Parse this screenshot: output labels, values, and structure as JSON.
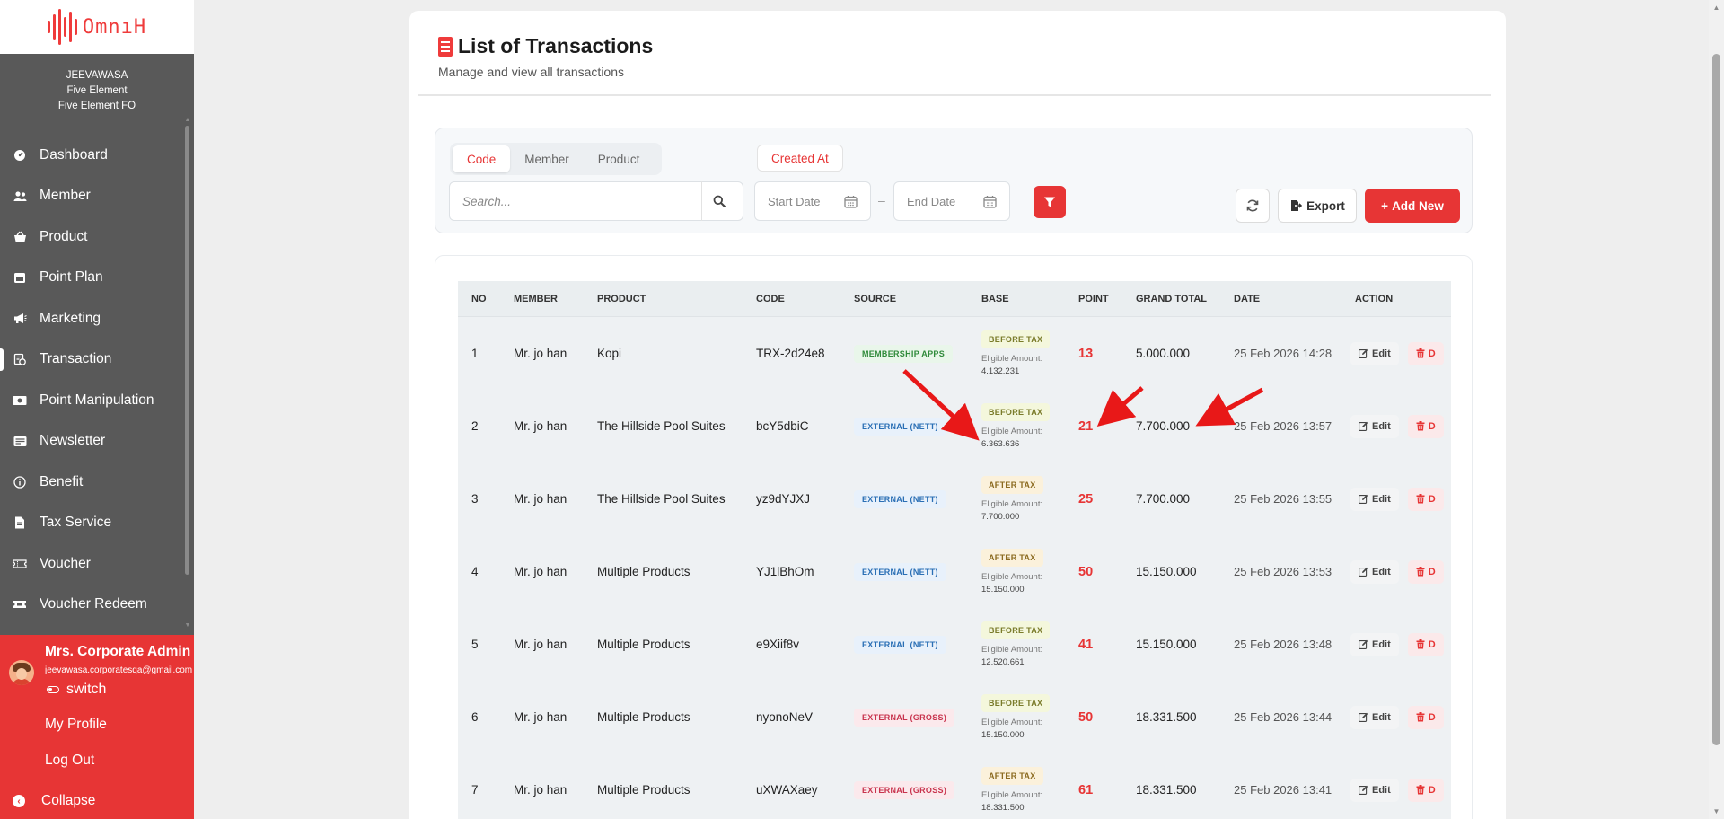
{
  "brand": {
    "logo_text": "OmnıH",
    "accent": "#e73535"
  },
  "org": {
    "line1": "JEEVAWASA",
    "line2": "Five Element",
    "line3": "Five Element FO"
  },
  "nav": [
    {
      "label": "Dashboard",
      "icon": "dashboard-icon"
    },
    {
      "label": "Member",
      "icon": "users-icon"
    },
    {
      "label": "Product",
      "icon": "basket-icon"
    },
    {
      "label": "Point Plan",
      "icon": "calendar-icon"
    },
    {
      "label": "Marketing",
      "icon": "megaphone-icon"
    },
    {
      "label": "Transaction",
      "icon": "transaction-icon",
      "active": true
    },
    {
      "label": "Point Manipulation",
      "icon": "money-icon"
    },
    {
      "label": "Newsletter",
      "icon": "newsletter-icon"
    },
    {
      "label": "Benefit",
      "icon": "info-icon"
    },
    {
      "label": "Tax Service",
      "icon": "document-icon"
    },
    {
      "label": "Voucher",
      "icon": "voucher-icon"
    },
    {
      "label": "Voucher Redeem",
      "icon": "ticket-icon"
    }
  ],
  "user": {
    "name": "Mrs. Corporate Admin",
    "email": "jeevawasa.corporatesqa@gmail.com",
    "switch_label": "switch",
    "profile_label": "My Profile",
    "logout_label": "Log Out",
    "collapse_label": "Collapse"
  },
  "page": {
    "title": "List of Transactions",
    "subtitle": "Manage and view all transactions"
  },
  "filters": {
    "tabs": [
      {
        "label": "Code",
        "active": true
      },
      {
        "label": "Member"
      },
      {
        "label": "Product"
      }
    ],
    "created_at_label": "Created At",
    "search_placeholder": "Search...",
    "start_date_placeholder": "Start Date",
    "end_date_placeholder": "End Date",
    "date_separator": "–",
    "export_label": "Export",
    "add_new_label": "Add New"
  },
  "table": {
    "columns": [
      "NO",
      "MEMBER",
      "PRODUCT",
      "CODE",
      "SOURCE",
      "BASE",
      "POINT",
      "GRAND TOTAL",
      "DATE",
      "ACTION"
    ],
    "eligible_label": "Eligible Amount:",
    "edit_label": "Edit",
    "delete_label": "D",
    "rows": [
      {
        "no": "1",
        "member": "Mr. jo han",
        "product": "Kopi",
        "code": "TRX-2d24e8",
        "source": "MEMBERSHIP APPS",
        "source_type": "green",
        "base": "BEFORE TAX",
        "eligible": "4.132.231",
        "point": "13",
        "grand_total": "5.000.000",
        "date": "25 Feb 2026 14:28"
      },
      {
        "no": "2",
        "member": "Mr. jo han",
        "product": "The Hillside Pool Suites",
        "code": "bcY5dbiC",
        "source": "EXTERNAL (NETT)",
        "source_type": "blue",
        "base": "BEFORE TAX",
        "eligible": "6.363.636",
        "point": "21",
        "grand_total": "7.700.000",
        "date": "25 Feb 2026 13:57"
      },
      {
        "no": "3",
        "member": "Mr. jo han",
        "product": "The Hillside Pool Suites",
        "code": "yz9dYJXJ",
        "source": "EXTERNAL (NETT)",
        "source_type": "blue",
        "base": "AFTER TAX",
        "eligible": "7.700.000",
        "point": "25",
        "grand_total": "7.700.000",
        "date": "25 Feb 2026 13:55"
      },
      {
        "no": "4",
        "member": "Mr. jo han",
        "product": "Multiple Products",
        "code": "YJ1lBhOm",
        "source": "EXTERNAL (NETT)",
        "source_type": "blue",
        "base": "AFTER TAX",
        "eligible": "15.150.000",
        "point": "50",
        "grand_total": "15.150.000",
        "date": "25 Feb 2026 13:53"
      },
      {
        "no": "5",
        "member": "Mr. jo han",
        "product": "Multiple Products",
        "code": "e9Xiif8v",
        "source": "EXTERNAL (NETT)",
        "source_type": "blue",
        "base": "BEFORE TAX",
        "eligible": "12.520.661",
        "point": "41",
        "grand_total": "15.150.000",
        "date": "25 Feb 2026 13:48"
      },
      {
        "no": "6",
        "member": "Mr. jo han",
        "product": "Multiple Products",
        "code": "nyonoNeV",
        "source": "EXTERNAL (GROSS)",
        "source_type": "red",
        "base": "BEFORE TAX",
        "eligible": "15.150.000",
        "point": "50",
        "grand_total": "18.331.500",
        "date": "25 Feb 2026 13:44"
      },
      {
        "no": "7",
        "member": "Mr. jo han",
        "product": "Multiple Products",
        "code": "uXWAXaey",
        "source": "EXTERNAL (GROSS)",
        "source_type": "red",
        "base": "AFTER TAX",
        "eligible": "18.331.500",
        "point": "61",
        "grand_total": "18.331.500",
        "date": "25 Feb 2026 13:41"
      }
    ]
  }
}
